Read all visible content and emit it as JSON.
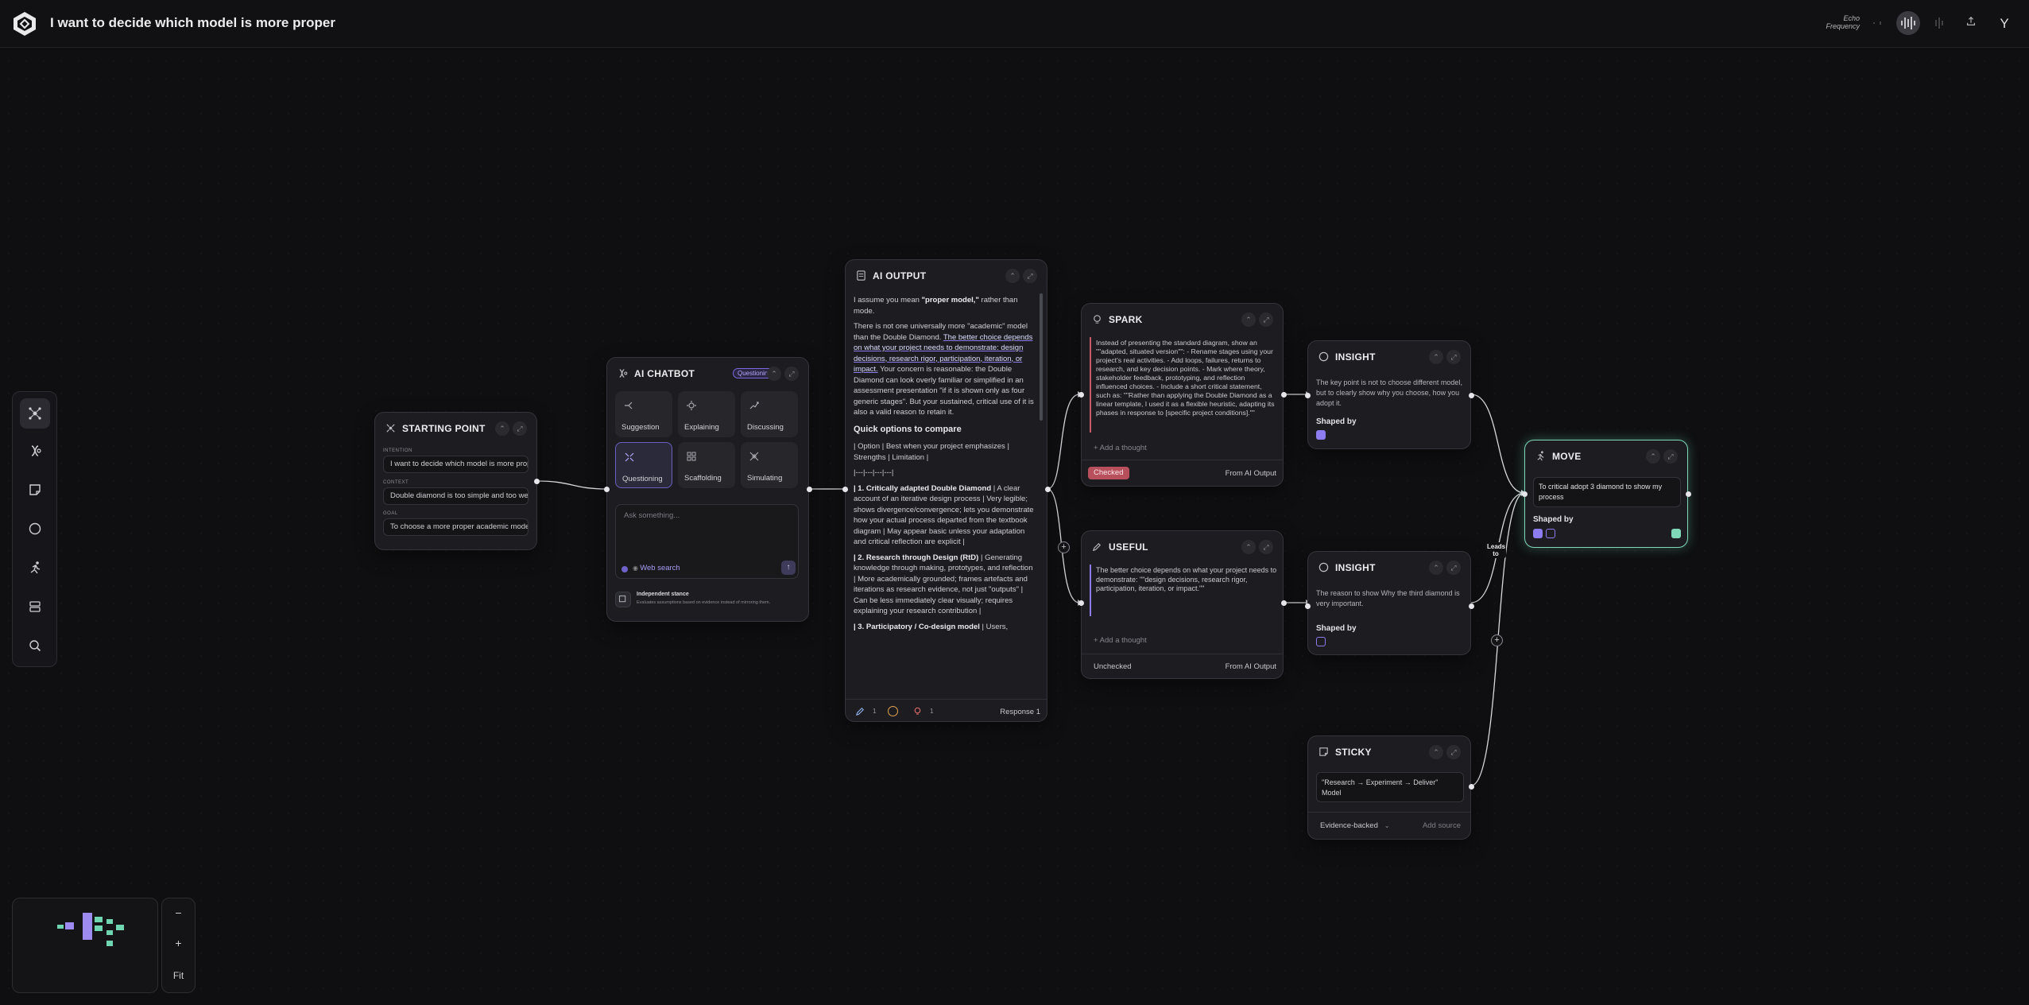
{
  "header": {
    "title": "I want to decide which model is more proper",
    "echo_line1": "Echo",
    "echo_line2": "Frequency",
    "avatar_letter": "Y"
  },
  "zoom": {
    "minus": "−",
    "plus": "+",
    "fit": "Fit"
  },
  "starting_point": {
    "title": "STARTING POINT",
    "intention_label": "INTENTION",
    "intention_value": "I want to decide which model is more proper",
    "context_label": "CONTEXT",
    "context_value": "Double diamond is too simple and too well-known",
    "goal_label": "GOAL",
    "goal_value": "To choose a more proper academic model"
  },
  "chatbot": {
    "title": "AI CHATBOT",
    "mode_badge": "Questioning",
    "modes": [
      "Suggestion",
      "Explaining",
      "Discussing",
      "Questioning",
      "Scaffolding",
      "Simulating"
    ],
    "ask_placeholder": "Ask something...",
    "web_search": "Web search",
    "stance_title": "Independent stance",
    "stance_desc": "Evaluates assumptions based on evidence instead of mirroring them."
  },
  "ai_output": {
    "title": "AI OUTPUT",
    "p1_a": "I assume you mean ",
    "p1_b": "\"proper model,\"",
    "p1_c": " rather than mode.",
    "p2_a": "There is not one universally more \"academic\" model than the Double Diamond. ",
    "p2_b": "The better choice depends on what your project needs to demonstrate: design decisions, research rigor, participation, iteration, or impact.",
    "p2_c": " Your concern is reasonable: the Double Diamond can look overly familiar or simplified in an assessment presentation \"if it is shown only as four generic stages\". But your sustained, critical use of it is also a valid reason to retain it.",
    "heading": "Quick options to compare",
    "table_head": "| Option | Best when your project emphasizes | Strengths | Limitation |",
    "table_sep": "|---|---|---|---|",
    "opt1_title": "| 1. Critically adapted Double Diamond",
    "opt1_text": " | A clear account of an iterative design process | Very legible; shows divergence/convergence; lets you demonstrate how your actual process departed from the textbook diagram | May appear basic unless your adaptation and critical reflection are explicit |",
    "opt2_title": "| 2. Research through Design (RtD)",
    "opt2_text": " | Generating knowledge through making, prototypes, and reflection | More academically grounded; frames artefacts and iterations as research evidence, not just \"outputs\" | Can be less immediately clear visually; requires explaining your research contribution |",
    "opt3_title": "| 3. Participatory / Co-design model",
    "opt3_text": " | Users,",
    "count_edits": "1",
    "count_sparks": "1",
    "response_label": "Response 1"
  },
  "spark": {
    "title": "SPARK",
    "text": "Instead of presenting the standard diagram, show an \"\"adapted, situated version\"\": - Rename stages using your project's real activities. - Add loops, failures, returns to research, and key decision points. - Mark where theory, stakeholder feedback, prototyping, and reflection influenced choices. - Include a short critical statement, such as: \"\"Rather than applying the Double Diamond as a linear template, I used it as a flexible heuristic, adapting its phases in response to [specific project conditions].\"\"",
    "add_thought": "+ Add a thought",
    "status": "Checked",
    "source": "From AI Output"
  },
  "useful": {
    "title": "USEFUL",
    "text": "The better choice depends on what your project needs to demonstrate: \"\"design decisions, research rigor, participation, iteration, or impact.\"\"",
    "add_thought": "+ Add a thought",
    "status": "Unchecked",
    "source": "From AI Output"
  },
  "insight1": {
    "title": "INSIGHT",
    "text": "The key point is not to choose different model, but to clearly show why you choose, how you adopt it.",
    "shaped_by": "Shaped by"
  },
  "insight2": {
    "title": "INSIGHT",
    "text": "The reason to show Why the third diamond is very important.",
    "shaped_by": "Shaped by"
  },
  "sticky": {
    "title": "STICKY",
    "text": "\"Research → Experiment → Deliver\" Model",
    "evidence": "Evidence-backed",
    "add_source": "Add source"
  },
  "move": {
    "title": "MOVE",
    "text": "To critical adopt 3 diamond to show my process",
    "shaped_by": "Shaped by"
  },
  "edge_label": "Leads to"
}
